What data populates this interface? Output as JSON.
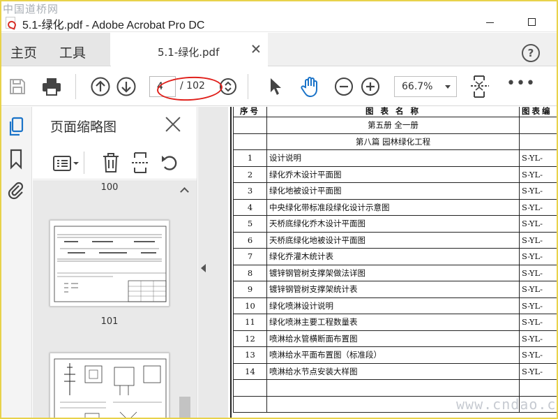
{
  "watermark_top": "中国道桥网",
  "watermark_bottom": "www.cndao.com",
  "window": {
    "title": "5.1-绿化.pdf - Adobe Acrobat Pro DC"
  },
  "menu": {
    "home": "主页",
    "tools": "工具"
  },
  "tab": {
    "label": "5.1-绿化.pdf"
  },
  "help_icon": "?",
  "toolbar": {
    "current_page": "4",
    "page_total": "/ 102",
    "zoom": "66.7%",
    "more": "•••"
  },
  "panel": {
    "title": "页面缩略图",
    "thumbnails": [
      {
        "number": "100"
      },
      {
        "number": "101"
      }
    ]
  },
  "document": {
    "headers": [
      "序号",
      "图 表 名 称",
      "图表编"
    ],
    "section_rows": [
      "第五册 全一册",
      "第八篇 园林绿化工程"
    ],
    "rows": [
      {
        "no": "1",
        "name": "设计说明",
        "code": "S-YL-"
      },
      {
        "no": "2",
        "name": "绿化乔木设计平面图",
        "code": "S-YL-"
      },
      {
        "no": "3",
        "name": "绿化地被设计平面图",
        "code": "S-YL-"
      },
      {
        "no": "4",
        "name": "中央绿化带标准段绿化设计示意图",
        "code": "S-YL-"
      },
      {
        "no": "5",
        "name": "天桥底绿化乔木设计平面图",
        "code": "S-YL-"
      },
      {
        "no": "6",
        "name": "天桥底绿化地被设计平面图",
        "code": "S-YL-"
      },
      {
        "no": "7",
        "name": "绿化乔灌木统计表",
        "code": "S-YL-"
      },
      {
        "no": "8",
        "name": "镀锌钢管树支撑架做法详图",
        "code": "S-YL-"
      },
      {
        "no": "9",
        "name": "镀锌钢管树支撑架统计表",
        "code": "S-YL-"
      },
      {
        "no": "10",
        "name": "绿化喷淋设计说明",
        "code": "S-YL-"
      },
      {
        "no": "11",
        "name": "绿化喷淋主要工程数量表",
        "code": "S-YL-"
      },
      {
        "no": "12",
        "name": "喷淋给水管横断面布置图",
        "code": "S-YL-"
      },
      {
        "no": "13",
        "name": "喷淋给水平面布置图（标准段）",
        "code": "S-YL-"
      },
      {
        "no": "14",
        "name": "喷淋给水节点安装大样图",
        "code": "S-YL-"
      }
    ]
  },
  "colors": {
    "highlight_ellipse": "#e0201b",
    "menu_bg": "#e6e6e6",
    "hand_tool": "#1a73c8",
    "active_rail_icon": "#1a73c8"
  }
}
